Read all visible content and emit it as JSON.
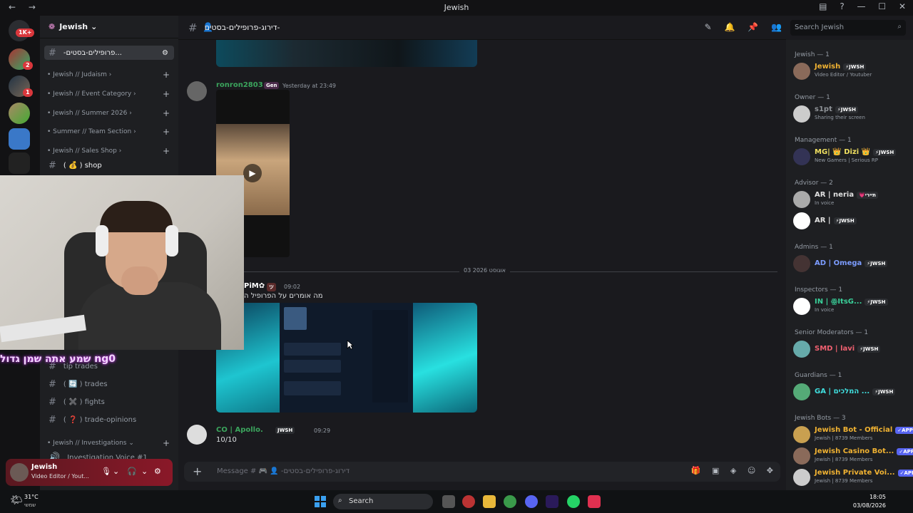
{
  "window": {
    "title": "Jewish",
    "nav_back": "←",
    "nav_fwd": "→",
    "min": "—",
    "max": "☐",
    "close": "✕"
  },
  "server": {
    "name": "Jewish",
    "name_arrow": "⌄"
  },
  "guild_badges": [
    "1K+",
    "2",
    "1"
  ],
  "categories": [
    {
      "label": "• Jewish // Judaism  ›"
    },
    {
      "label": "• Jewish // Event Category  ›"
    },
    {
      "label": "• Jewish // Summer 2026  ›"
    },
    {
      "label": "• Summer // Team Section  ›"
    },
    {
      "label": "• Jewish // Sales Shop  ›"
    },
    {
      "label": "• Jewish // Investigations  ⌄"
    }
  ],
  "channels": {
    "active": "-פרופילים-בסטים...",
    "shop": "( 💰 )  shop",
    "tip_trades": "tip trades",
    "trades": "( 🔄 )  trades",
    "fights": "( ✖️ )  fights",
    "trade_opinions": "( ❓ )  trade-opinions",
    "investigation_voice": "Investigation Voice #1"
  },
  "user": {
    "name": "Jewish",
    "status": "Video Editor / Yout..."
  },
  "caption": "שמע אתה שמן גדול ng0",
  "chat_header": {
    "channel": "דירוג-פרופילים-בסטים-"
  },
  "search_placeholder": "Search Jewish",
  "messages": [
    {
      "user": "ronron2803",
      "tag": "Gen",
      "time": "Yesterday at 23:49"
    },
    {
      "user": "PiM✿",
      "tag": "ツ",
      "time": "09:02",
      "text": "מה אומרים על הפרופיל ה"
    },
    {
      "user": "CO | Apollo.",
      "tag": "JWSH",
      "time": "09:29",
      "text": "10/10"
    }
  ],
  "date_divider": "03 אוגוסט 2026",
  "composer_placeholder": "Message # 🎮 👤 -דירוג-פרופילים-בסטים",
  "member_sections": [
    {
      "title": "Jewish — 1",
      "members": [
        {
          "name": "Jewish",
          "tag": "⚡JWSH",
          "sub": "Video Editor / Youtuber",
          "color": "#f0b232"
        }
      ]
    },
    {
      "title": "Owner — 1",
      "members": [
        {
          "name": "ꜱ1pt",
          "tag": "⚡JWSH",
          "sub": "Sharing their screen",
          "color": "#8e9297"
        }
      ]
    },
    {
      "title": "Management — 1",
      "members": [
        {
          "name": "MG| 👑 Dizi 👑",
          "tag": "⚡JWSH",
          "sub": "New Gamers | Serious RP",
          "color": "#f0e060"
        }
      ]
    },
    {
      "title": "Advisor — 2",
      "members": [
        {
          "name": "AR | neria",
          "tag": "💗תיירי",
          "sub": "In voice",
          "color": "#e0e0e0"
        },
        {
          "name": "AR |",
          "tag": "⚡JWSH",
          "sub": "",
          "color": "#e0e0e0"
        }
      ]
    },
    {
      "title": "Admins — 1",
      "members": [
        {
          "name": "AD | Omega",
          "tag": "⚡JWSH",
          "sub": "",
          "color": "#7c9cff"
        }
      ]
    },
    {
      "title": "Inspectors — 1",
      "members": [
        {
          "name": "IN | ꙮItsG...",
          "tag": "⚡JWSH",
          "sub": "In voice",
          "color": "#3ad19a"
        }
      ]
    },
    {
      "title": "Senior Moderators — 1",
      "members": [
        {
          "name": "SMD | lavi",
          "tag": "⚡JWSH",
          "sub": "",
          "color": "#f06070"
        }
      ]
    },
    {
      "title": "Guardians — 1",
      "members": [
        {
          "name": "GA | המלכים ...",
          "tag": "⚡JWSH",
          "sub": "",
          "color": "#40e0e0"
        }
      ]
    },
    {
      "title": "Jewish Bots — 3",
      "members": [
        {
          "name": "Jewish Bot - Official",
          "tag": "✓APP",
          "sub": "Jewish | 8739 Members",
          "color": "#f0b232"
        },
        {
          "name": "Jewish Casino Bot...",
          "tag": "✓APP",
          "sub": "Jewish | 8739 Members",
          "color": "#f0b232"
        },
        {
          "name": "Jewish Private Voi...",
          "tag": "✓APP",
          "sub": "Jewish | 8739 Members",
          "color": "#f0b232"
        }
      ]
    }
  ],
  "taskbar": {
    "temp": "31°C",
    "temp_sub": "שמשי",
    "search": "Search",
    "time": "18:05",
    "date": "03/08/2026"
  }
}
